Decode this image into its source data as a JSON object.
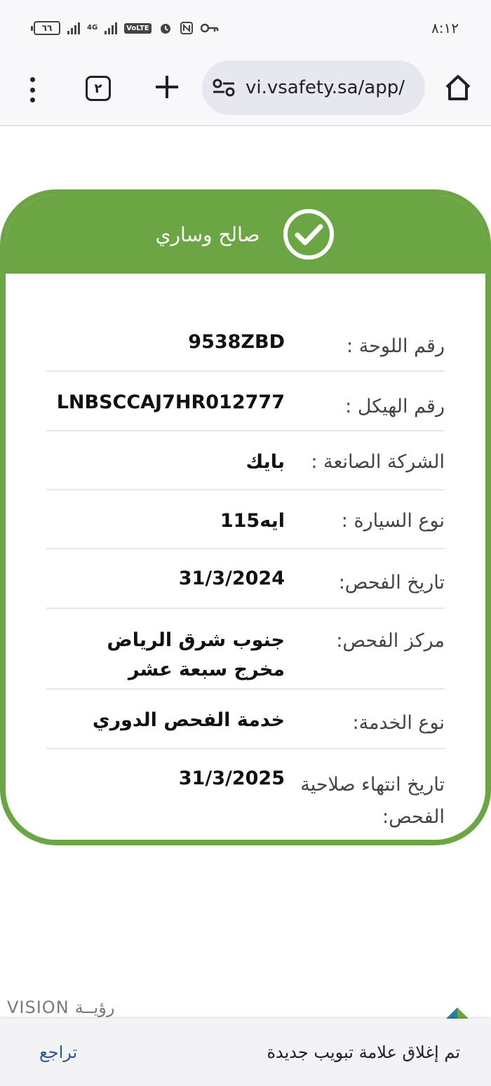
{
  "status_bar": {
    "time": "٨:١٢",
    "battery": "٦٦",
    "network_tag": "4G",
    "volte": "VoLTE"
  },
  "browser": {
    "tab_count": "٢",
    "url": "vi.vsafety.sa/app/"
  },
  "card": {
    "owner_name": "صالح وساري",
    "accent_color": "#6ca543",
    "rows": [
      {
        "label": "رقم اللوحة :",
        "value": "9538ZBD"
      },
      {
        "label": "رقم الهيكل :",
        "value": "LNBSCCAJ7HR012777"
      },
      {
        "label": "الشركة الصانعة :",
        "value": "بايك"
      },
      {
        "label": "نوع السيارة :",
        "value": "ايه115"
      },
      {
        "label": "تاريخ الفحص:",
        "value": "31/3/2024"
      },
      {
        "label": "مركز الفحص:",
        "value": "جنوب شرق الرياض مخرج سبعة عشر"
      },
      {
        "label": "نوع الخدمة:",
        "value": "خدمة الفحص الدوري"
      },
      {
        "label": "تاريخ انتهاء صلاحية الفحص:",
        "value": "31/3/2025"
      }
    ]
  },
  "footer": {
    "logo_en": "VISION",
    "logo_ar": "رؤيــة"
  },
  "snackbar": {
    "message": "تم إغلاق علامة تبويب جديدة",
    "undo_label": "تراجع"
  }
}
